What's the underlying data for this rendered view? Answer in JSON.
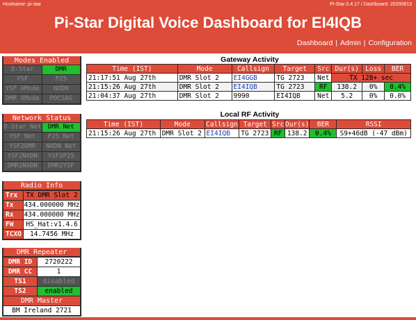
{
  "header": {
    "hostname": "Hostname: pi-star",
    "version": "Pi-Star:3.4.17 / Dashboard: 20200813",
    "title": "Pi-Star Digital Voice Dashboard for EI4IQB",
    "nav": [
      "Dashboard",
      "Admin",
      "Configuration"
    ]
  },
  "modes_enabled": {
    "title": "Modes Enabled",
    "items": [
      {
        "label": "D-Star",
        "on": false
      },
      {
        "label": "DMR",
        "on": true
      },
      {
        "label": "YSF",
        "on": false
      },
      {
        "label": "P25",
        "on": false
      },
      {
        "label": "YSF XMode",
        "on": false
      },
      {
        "label": "NXDN",
        "on": false
      },
      {
        "label": "DMR XMode",
        "on": false
      },
      {
        "label": "POCSAG",
        "on": false
      }
    ]
  },
  "network_status": {
    "title": "Network Status",
    "items": [
      {
        "label": "D-Star Net",
        "on": false
      },
      {
        "label": "DMR Net",
        "on": true
      },
      {
        "label": "YSF Net",
        "on": false
      },
      {
        "label": "P25 Net",
        "on": false
      },
      {
        "label": "YSF2DMR",
        "on": false
      },
      {
        "label": "NXDN Net",
        "on": false
      },
      {
        "label": "YSF2NXDN",
        "on": false
      },
      {
        "label": "YSF2P25",
        "on": false
      },
      {
        "label": "DMR2NXDN",
        "on": false
      },
      {
        "label": "DMR2YSF",
        "on": false
      }
    ]
  },
  "radio_info": {
    "title": "Radio Info",
    "rows": [
      {
        "key": "Trx",
        "value": "TX DMR Slot 2"
      },
      {
        "key": "Tx",
        "value": "434.000000 MHz"
      },
      {
        "key": "Rx",
        "value": "434.000000 MHz"
      },
      {
        "key": "FW",
        "value": "HS_Hat:v1.4.6"
      },
      {
        "key": "TCXO",
        "value": "14.7456 MHz"
      }
    ]
  },
  "dmr_repeater": {
    "title": "DMR Repeater",
    "rows": [
      {
        "key": "DMR ID",
        "value": "2720222"
      },
      {
        "key": "DMR CC",
        "value": "1"
      },
      {
        "key": "TS1",
        "value": "disabled"
      },
      {
        "key": "TS2",
        "value": "enabled"
      }
    ],
    "master_title": "DMR Master",
    "master_value": "BM Ireland 2721"
  },
  "gateway_activity": {
    "title": "Gateway Activity",
    "headers": [
      "Time (IST)",
      "Mode",
      "Callsign",
      "Target",
      "Src",
      "Dur(s)",
      "Loss",
      "BER"
    ],
    "rows": [
      {
        "time": "21:17:51 Aug 27th",
        "mode": "DMR Slot 2",
        "callsign": "EI4GGB",
        "target": "TG 2723",
        "src": "Net",
        "dur": "TX 128+ sec",
        "loss": "",
        "ber": ""
      },
      {
        "time": "21:15:26 Aug 27th",
        "mode": "DMR Slot 2",
        "callsign": "EI4IQB",
        "target": "TG 2723",
        "src": "RF",
        "dur": "138.2",
        "loss": "0%",
        "ber": "0.4%"
      },
      {
        "time": "21:04:37 Aug 27th",
        "mode": "DMR Slot 2",
        "callsign": "9990",
        "target": "EI4IQB",
        "src": "Net",
        "dur": "5.2",
        "loss": "0%",
        "ber": "0.0%"
      }
    ]
  },
  "local_rf_activity": {
    "title": "Local RF Activity",
    "headers": [
      "Time (IST)",
      "Mode",
      "Callsign",
      "Target",
      "Src",
      "Dur(s)",
      "BER",
      "RSSI"
    ],
    "rows": [
      {
        "time": "21:15:26 Aug 27th",
        "mode": "DMR Slot 2",
        "callsign": "EI4IQB",
        "target": "TG 2723",
        "src": "RF",
        "dur": "138.2",
        "ber": "0.4%",
        "rssi": "S9+46dB (-47 dBm)"
      }
    ]
  },
  "colors": {
    "accent": "#dd4b39",
    "enabled": "#1fbf2f",
    "disabled": "#535353",
    "link": "#1a3fb0"
  }
}
